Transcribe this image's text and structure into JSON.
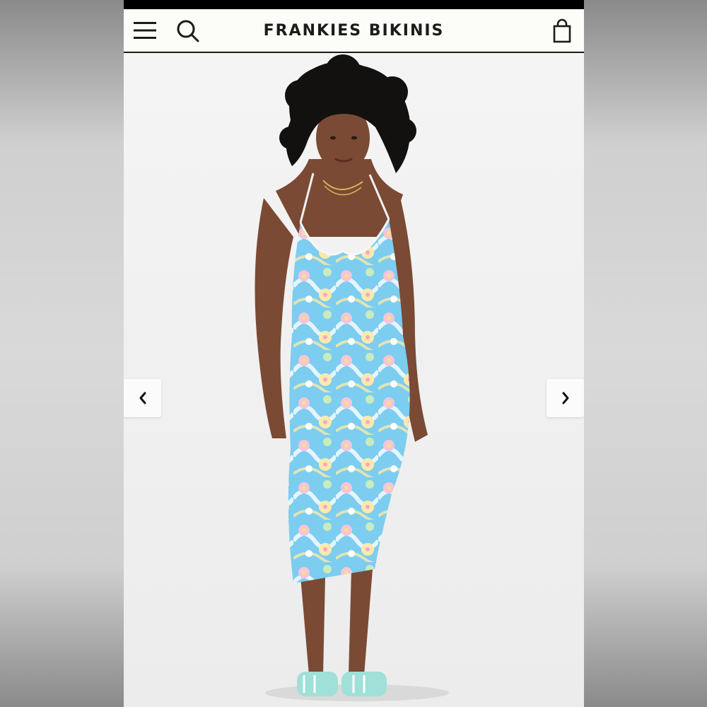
{
  "header": {
    "brand": "FRANKIES BIKINIS",
    "icons": {
      "menu": "hamburger-menu-icon",
      "search": "search-icon",
      "cart": "shopping-bag-icon"
    }
  },
  "carousel": {
    "prev_icon": "chevron-left-icon",
    "next_icon": "chevron-right-icon",
    "image": {
      "garment_print_colors": [
        "#6cc6ec",
        "#f4c2d8",
        "#f6e9a6",
        "#c5e8b8",
        "#ffffff"
      ],
      "sandal_color": "#9fe0d8"
    }
  },
  "colors": {
    "header_bg": "#fcfcf8",
    "brand_text": "#1b1b1b",
    "page_bg": "#f2f2f2"
  }
}
